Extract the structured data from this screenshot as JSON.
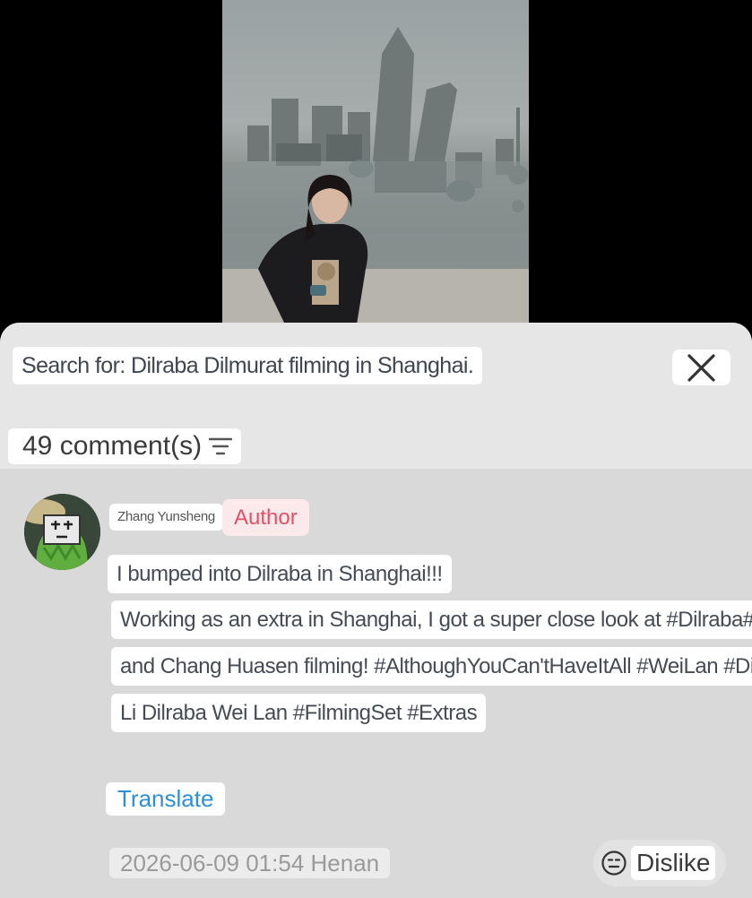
{
  "search": {
    "label": "Search for: Dilraba Dilmurat filming in Shanghai."
  },
  "comments_header": {
    "count_label": "49 comment(s)"
  },
  "comment": {
    "username": "Zhang Yunsheng",
    "badge": "Author",
    "lines": [
      "I bumped into Dilraba in Shanghai!!!",
      "Working as an extra in Shanghai, I got a super close look at #Dilraba#",
      "and Chang Huasen filming! #AlthoughYouCan'tHaveItAll #WeiLan #Di",
      "Li Dilraba Wei Lan #FilmingSet #Extras"
    ],
    "translate_label": "Translate",
    "meta": "2026-06-09 01:54 Henan",
    "dislike_label": "Dislike"
  },
  "colors": {
    "author_badge": "#e05268",
    "translate_link": "#2f8fd6",
    "sheet_bg": "#d9d9d9"
  },
  "icons": [
    "close-icon",
    "sort-filter-icon",
    "avatar-image",
    "neutral-face-icon"
  ]
}
